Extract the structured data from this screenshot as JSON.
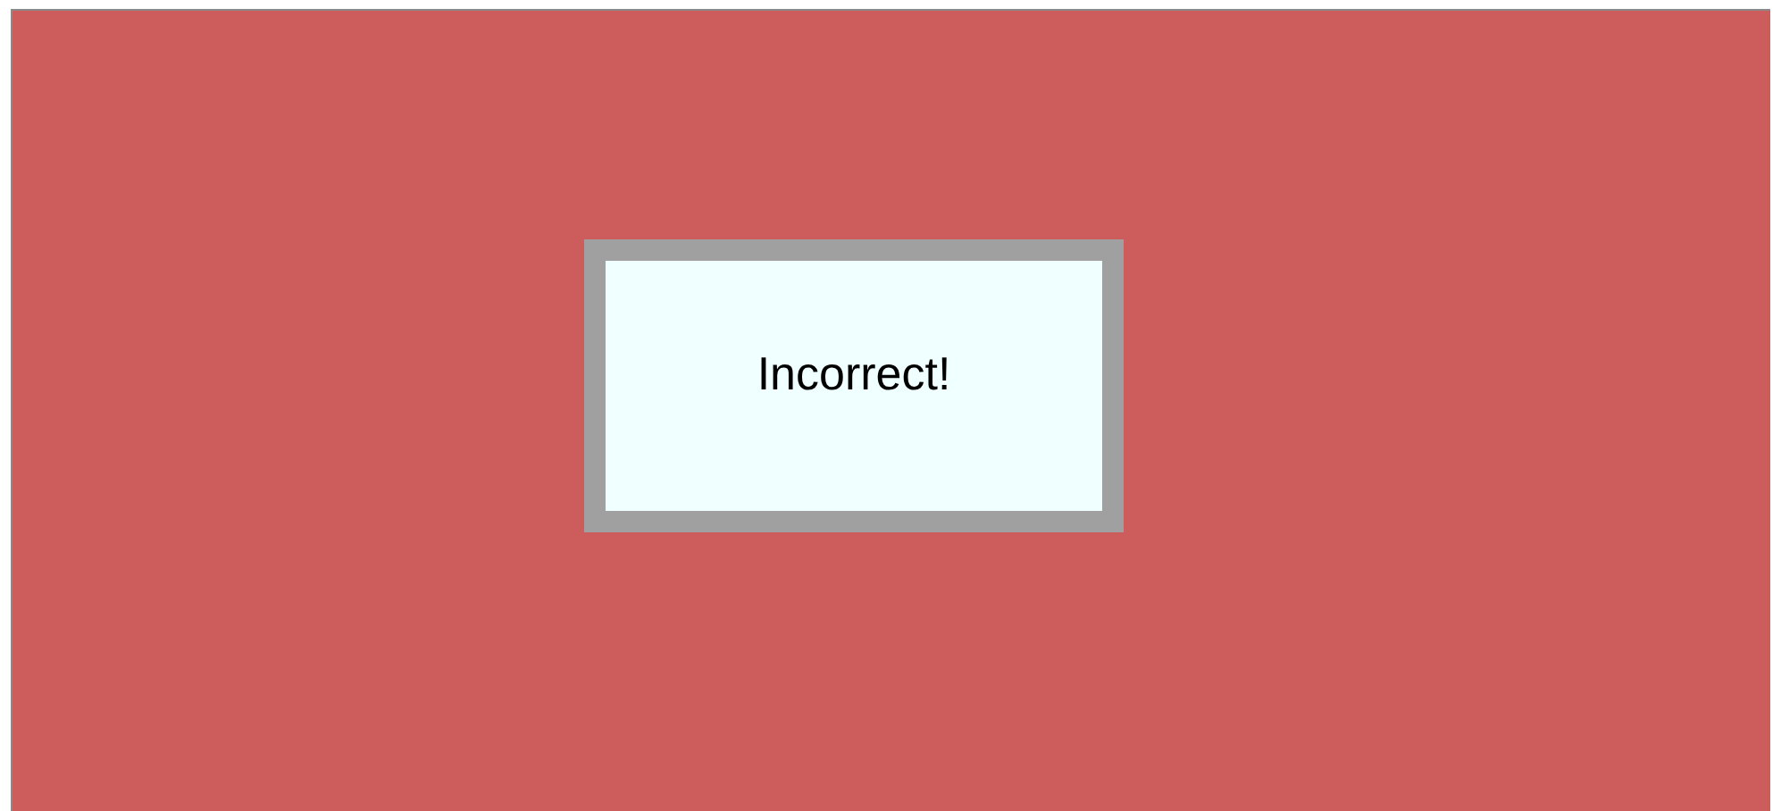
{
  "result": {
    "text": "Incorrect!",
    "correct": false
  }
}
